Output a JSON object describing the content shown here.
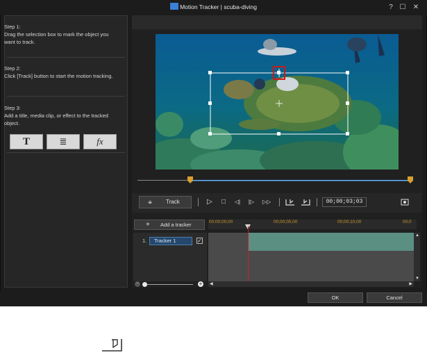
{
  "window": {
    "title": "Motion Tracker | scuba-diving",
    "help": "?",
    "maximize": "☐",
    "close": "✕"
  },
  "steps": [
    {
      "heading": "Step 1:",
      "text": "Drag the selection box to mark the object you want to track."
    },
    {
      "heading": "Step 2:",
      "text": "Click [Track] button to start the motion tracking."
    },
    {
      "heading": "Step 3:",
      "text": "Add a title, media clip, or effect to the tracked object."
    }
  ],
  "tools": {
    "title": "T",
    "media": "≣",
    "effect": "fx"
  },
  "controls": {
    "track_label": "Track",
    "timecode": "00;00;03;03",
    "play": "▷",
    "stop": "□",
    "prev_frame": "◁|",
    "next_frame": "|▷",
    "fast_forward": "▷▷"
  },
  "trackers": {
    "add_label": "Add a tracker",
    "items": [
      {
        "index": "1.",
        "name": "Tracker 1",
        "checked": true
      }
    ],
    "ruler": [
      "00;00;00;00",
      "00;00;05;00",
      "00;00;10;00",
      "00;0"
    ]
  },
  "buttons": {
    "ok": "OK",
    "cancel": "Cancel"
  },
  "colors": {
    "accent": "#3b7fd8",
    "clip": "#5b8f82",
    "playhead": "#d02020",
    "ruler_text": "#c79b2e",
    "selection": "#ffffff",
    "target": "#d01818"
  }
}
